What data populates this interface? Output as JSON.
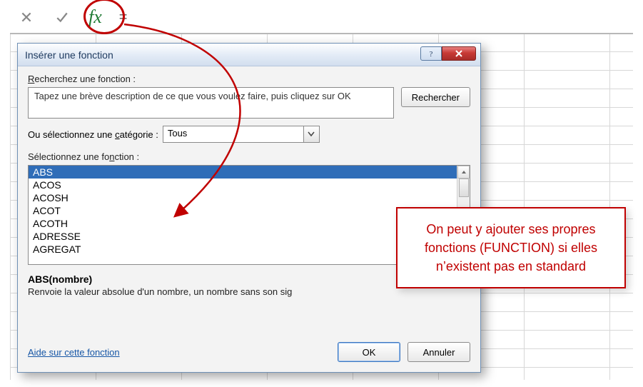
{
  "formula_bar": {
    "fx_label": "fx",
    "equals": "="
  },
  "dialog": {
    "title": "Insérer une fonction",
    "search_label_html": "Recherchez une fonction :",
    "search_placeholder": "Tapez une brève description de ce que vous voulez faire, puis cliquez sur OK",
    "search_button": "Rechercher",
    "category_label_html": "Ou sélectionnez une catégorie :",
    "category_value": "Tous",
    "select_label_html": "Sélectionnez une fonction :",
    "functions": [
      "ABS",
      "ACOS",
      "ACOSH",
      "ACOT",
      "ACOTH",
      "ADRESSE",
      "AGREGAT"
    ],
    "selected_index": 0,
    "signature": "ABS(nombre)",
    "description": "Renvoie la valeur absolue d'un nombre, un nombre sans son sig",
    "help_link": "Aide sur cette fonction",
    "ok_button": "OK",
    "cancel_button": "Annuler"
  },
  "annotation": {
    "text": "On peut y ajouter ses propres fonctions (FUNCTION) si elles n’existent pas en standard"
  }
}
